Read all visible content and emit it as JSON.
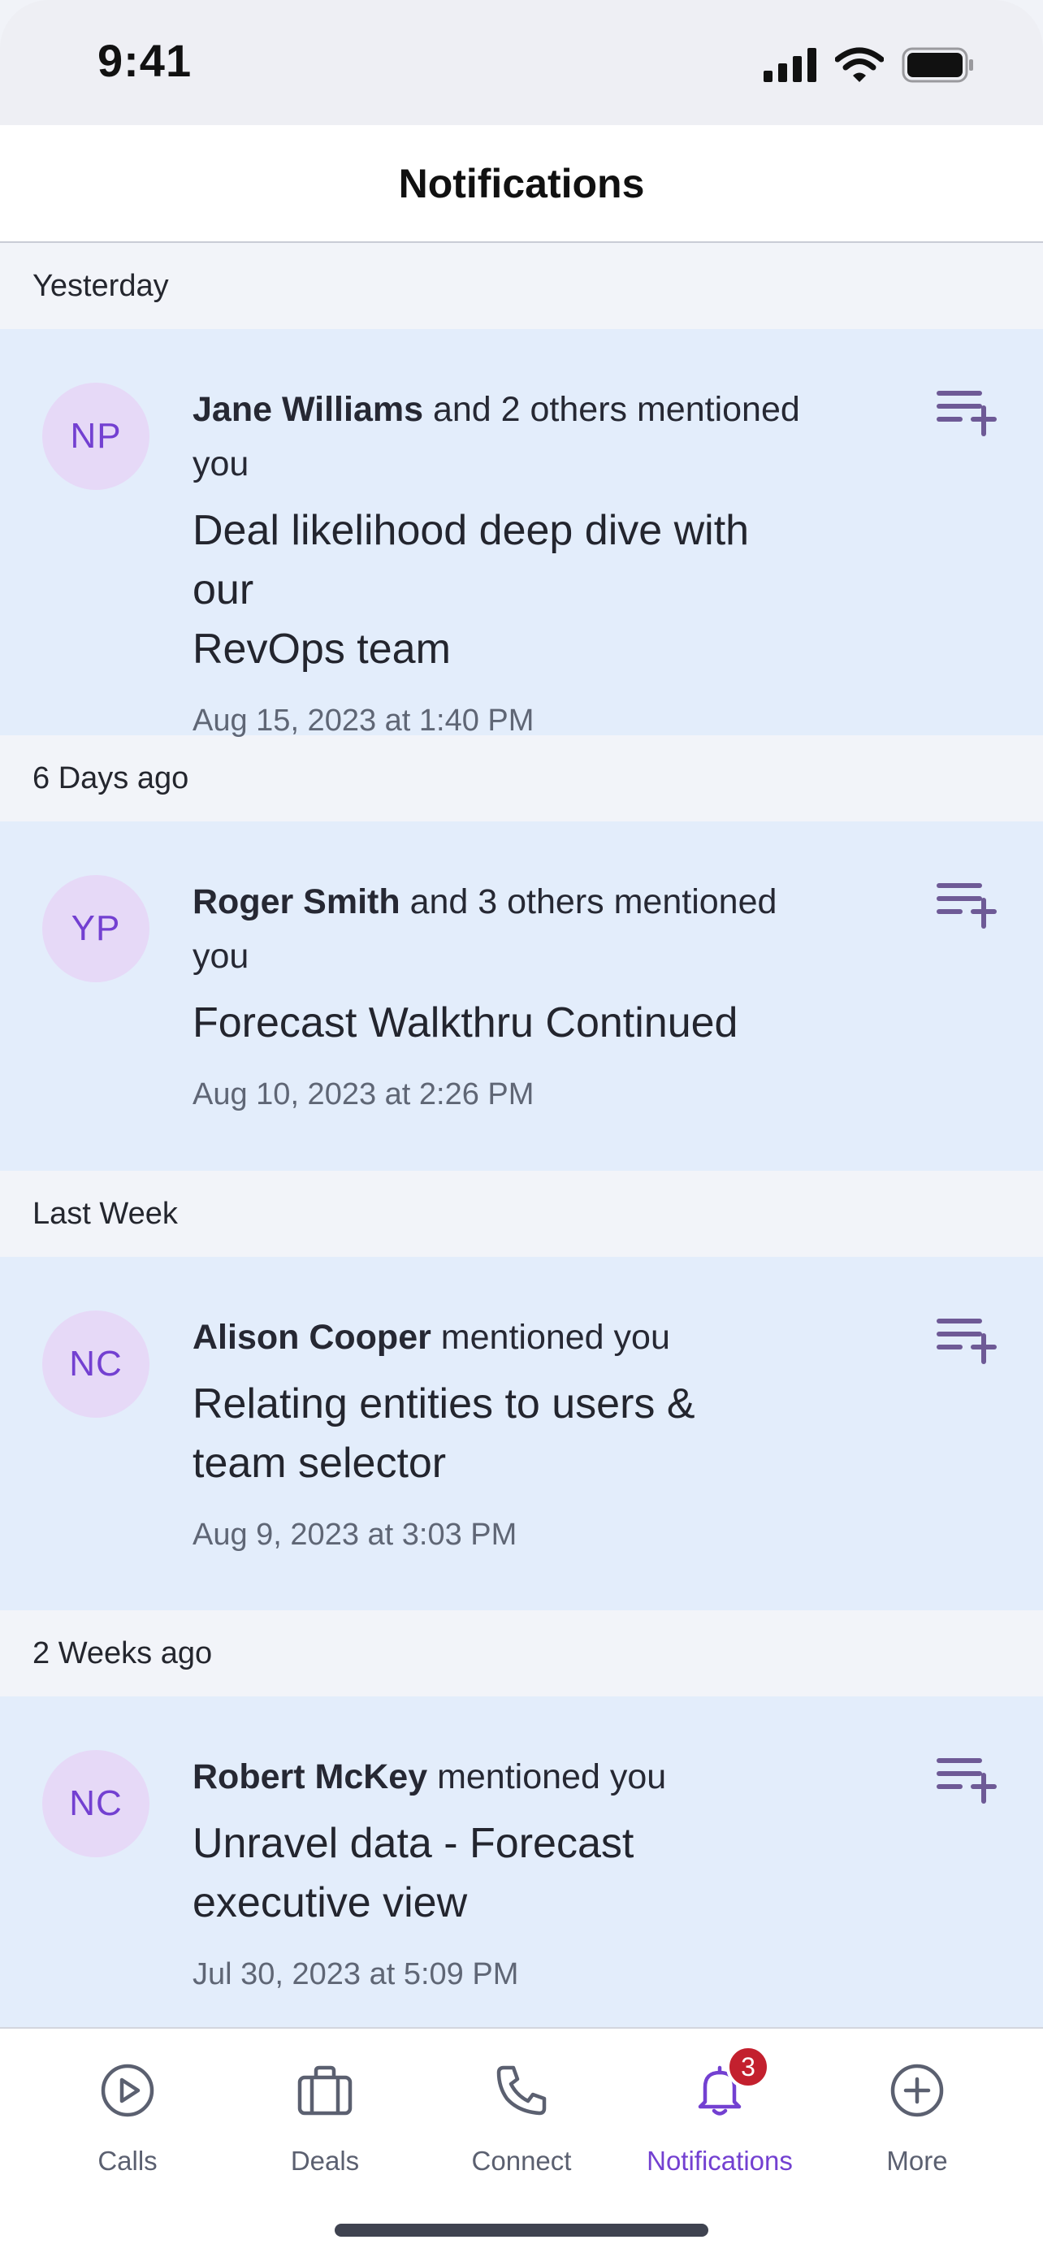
{
  "status_bar": {
    "time": "9:41"
  },
  "header": {
    "title": "Notifications"
  },
  "sections": [
    {
      "label": "Yesterday",
      "items": [
        {
          "avatar": "NP",
          "name": "Jane Williams",
          "action": " and 2 others mentioned you",
          "subject_lines": [
            "Deal likelihood deep dive with our",
            "RevOps team"
          ],
          "timestamp": "Aug 15, 2023 at 1:40 PM"
        }
      ]
    },
    {
      "label": "6 Days ago",
      "items": [
        {
          "avatar": "YP",
          "name": "Roger Smith",
          "action": " and 3 others mentioned you",
          "subject_lines": [
            "Forecast Walkthru Continued",
            ""
          ],
          "timestamp": "Aug 10, 2023 at 2:26 PM"
        }
      ]
    },
    {
      "label": "Last Week",
      "items": [
        {
          "avatar": "NC",
          "name": "Alison Cooper",
          "action": " mentioned you",
          "subject_lines": [
            "Relating entities to users &",
            "team selector"
          ],
          "timestamp": "Aug 9, 2023 at 3:03 PM"
        }
      ]
    },
    {
      "label": "2 Weeks ago",
      "items": [
        {
          "avatar": "NC",
          "name": "Robert McKey",
          "action": " mentioned you",
          "subject_lines": [
            "Unravel data - Forecast",
            "executive view"
          ],
          "timestamp": "Jul 30, 2023 at 5:09 PM"
        }
      ]
    }
  ],
  "tabbar": {
    "tabs": [
      {
        "label": "Calls",
        "icon": "play-circle-icon"
      },
      {
        "label": "Deals",
        "icon": "briefcase-icon"
      },
      {
        "label": "Connect",
        "icon": "phone-icon"
      },
      {
        "label": "Notifications",
        "icon": "bell-icon",
        "badge": "3",
        "active": true
      },
      {
        "label": "More",
        "icon": "plus-circle-icon"
      }
    ]
  },
  "colors": {
    "accent": "#7340d1",
    "card_bg": "#e3edfb",
    "badge": "#c3202e",
    "avatar_bg": "#e6d9f7"
  }
}
